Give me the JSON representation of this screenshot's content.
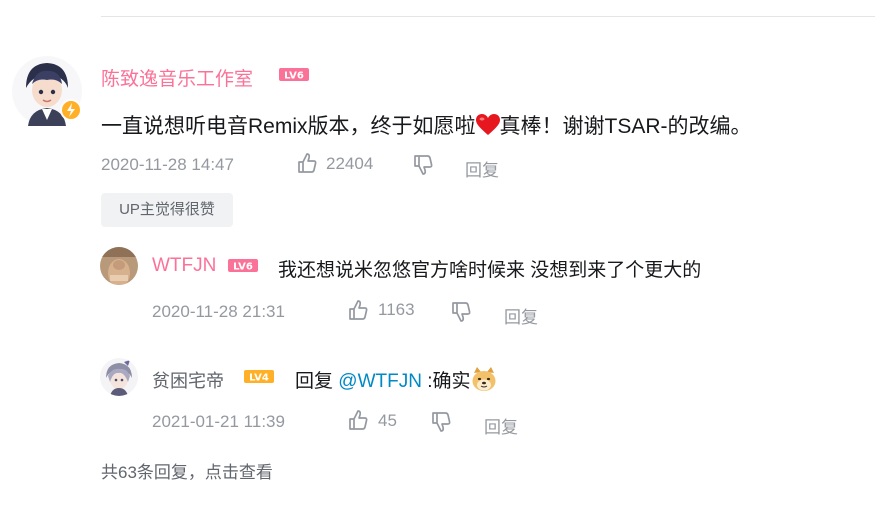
{
  "main_comment": {
    "username": "陈致逸音乐工作室",
    "level": "LV6",
    "content_before": "一直说想听电音Remix版本，终于如愿啦",
    "content_after": "真棒！谢谢TSAR-的改编。",
    "timestamp": "2020-11-28 14:47",
    "likes": "22404",
    "reply_label": "回复",
    "up_badge": "UP主觉得很赞"
  },
  "replies": [
    {
      "username": "WTFJN",
      "level": "LV6",
      "content": "我还想说米忽悠官方啥时候来 没想到来了个更大的",
      "timestamp": "2020-11-28 21:31",
      "likes": "1163",
      "reply_label": "回复"
    },
    {
      "username": "贫困宅帝",
      "level": "LV4",
      "content_prefix": "回复 ",
      "mention": "@WTFJN",
      "content_suffix": " :确实",
      "timestamp": "2021-01-21 11:39",
      "likes": "45",
      "reply_label": "回复"
    }
  ],
  "footer": {
    "more_replies": "共63条回复，点击查看"
  },
  "colors": {
    "username": "#fb7299",
    "lv6": "#fb7299",
    "lv4": "#ffb027",
    "meta": "#9499a0",
    "mention": "#008ac5"
  },
  "icons": [
    "thumb-up-icon",
    "thumb-down-icon",
    "lightning-icon",
    "heart-emoji",
    "doge-emoji"
  ]
}
